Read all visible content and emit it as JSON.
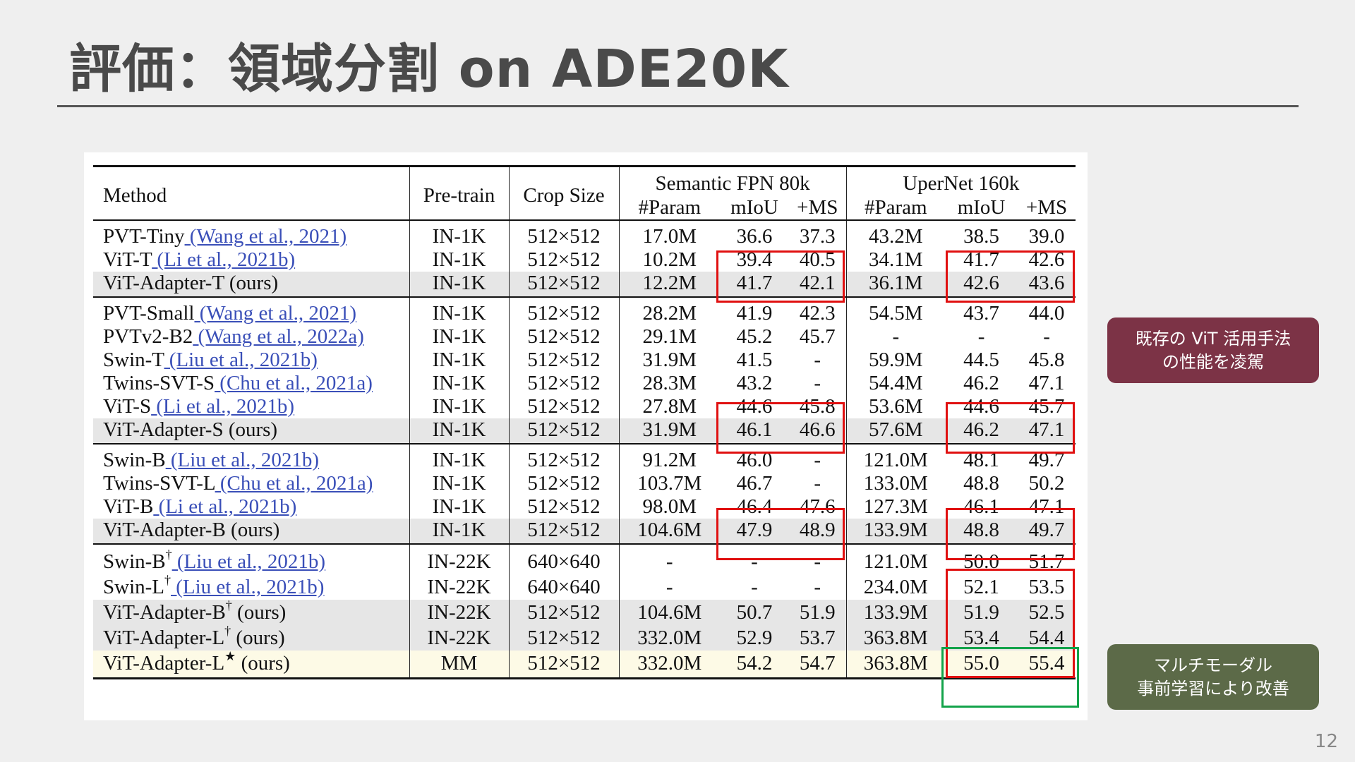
{
  "slide": {
    "title": "評価：領域分割 on ADE20K",
    "page_number": "12"
  },
  "table": {
    "header": {
      "method": "Method",
      "pretrain": "Pre-train",
      "crop": "Crop Size",
      "group1": "Semantic FPN 80k",
      "group2": "UperNet 160k",
      "param": "#Param",
      "miou": "mIoU",
      "ms": "+MS"
    },
    "groups": [
      [
        {
          "name": "PVT-Tiny",
          "cite": " (Wang et al., 2021)",
          "pretrain": "IN-1K",
          "crop": "512×512",
          "fpn_param": "17.0M",
          "fpn_miou": "36.6",
          "fpn_ms": "37.3",
          "up_param": "43.2M",
          "up_miou": "38.5",
          "up_ms": "39.0"
        },
        {
          "name": "ViT-T",
          "cite": " (Li et al., 2021b)",
          "pretrain": "IN-1K",
          "crop": "512×512",
          "fpn_param": "10.2M",
          "fpn_miou": "39.4",
          "fpn_ms": "40.5",
          "up_param": "34.1M",
          "up_miou": "41.7",
          "up_ms": "42.6"
        },
        {
          "name": "ViT-Adapter-T (ours)",
          "pretrain": "IN-1K",
          "crop": "512×512",
          "fpn_param": "12.2M",
          "fpn_miou": "41.7",
          "fpn_ms": "42.1",
          "up_param": "36.1M",
          "up_miou": "42.6",
          "up_ms": "43.6"
        }
      ],
      [
        {
          "name": "PVT-Small",
          "cite": " (Wang et al., 2021)",
          "pretrain": "IN-1K",
          "crop": "512×512",
          "fpn_param": "28.2M",
          "fpn_miou": "41.9",
          "fpn_ms": "42.3",
          "up_param": "54.5M",
          "up_miou": "43.7",
          "up_ms": "44.0"
        },
        {
          "name": "PVTv2-B2",
          "cite": " (Wang et al., 2022a)",
          "pretrain": "IN-1K",
          "crop": "512×512",
          "fpn_param": "29.1M",
          "fpn_miou": "45.2",
          "fpn_ms": "45.7",
          "up_param": "-",
          "up_miou": "-",
          "up_ms": "-"
        },
        {
          "name": "Swin-T",
          "cite": " (Liu et al., 2021b)",
          "pretrain": "IN-1K",
          "crop": "512×512",
          "fpn_param": "31.9M",
          "fpn_miou": "41.5",
          "fpn_ms": "-",
          "up_param": "59.9M",
          "up_miou": "44.5",
          "up_ms": "45.8"
        },
        {
          "name": "Twins-SVT-S",
          "cite": " (Chu et al., 2021a)",
          "pretrain": "IN-1K",
          "crop": "512×512",
          "fpn_param": "28.3M",
          "fpn_miou": "43.2",
          "fpn_ms": "-",
          "up_param": "54.4M",
          "up_miou": "46.2",
          "up_ms": "47.1"
        },
        {
          "name": "ViT-S",
          "cite": " (Li et al., 2021b)",
          "pretrain": "IN-1K",
          "crop": "512×512",
          "fpn_param": "27.8M",
          "fpn_miou": "44.6",
          "fpn_ms": "45.8",
          "up_param": "53.6M",
          "up_miou": "44.6",
          "up_ms": "45.7"
        },
        {
          "name": "ViT-Adapter-S (ours)",
          "pretrain": "IN-1K",
          "crop": "512×512",
          "fpn_param": "31.9M",
          "fpn_miou": "46.1",
          "fpn_ms": "46.6",
          "up_param": "57.6M",
          "up_miou": "46.2",
          "up_ms": "47.1"
        }
      ],
      [
        {
          "name": "Swin-B",
          "cite": " (Liu et al., 2021b)",
          "pretrain": "IN-1K",
          "crop": "512×512",
          "fpn_param": "91.2M",
          "fpn_miou": "46.0",
          "fpn_ms": "-",
          "up_param": "121.0M",
          "up_miou": "48.1",
          "up_ms": "49.7"
        },
        {
          "name": "Twins-SVT-L",
          "cite": " (Chu et al., 2021a)",
          "pretrain": "IN-1K",
          "crop": "512×512",
          "fpn_param": "103.7M",
          "fpn_miou": "46.7",
          "fpn_ms": "-",
          "up_param": "133.0M",
          "up_miou": "48.8",
          "up_ms": "50.2"
        },
        {
          "name": "ViT-B",
          "cite": " (Li et al., 2021b)",
          "pretrain": "IN-1K",
          "crop": "512×512",
          "fpn_param": "98.0M",
          "fpn_miou": "46.4",
          "fpn_ms": "47.6",
          "up_param": "127.3M",
          "up_miou": "46.1",
          "up_ms": "47.1"
        },
        {
          "name": "ViT-Adapter-B (ours)",
          "pretrain": "IN-1K",
          "crop": "512×512",
          "fpn_param": "104.6M",
          "fpn_miou": "47.9",
          "fpn_ms": "48.9",
          "up_param": "133.9M",
          "up_miou": "48.8",
          "up_ms": "49.7"
        }
      ],
      [
        {
          "name": "Swin-B",
          "sup": "†",
          "cite": " (Liu et al., 2021b)",
          "pretrain": "IN-22K",
          "crop": "640×640",
          "fpn_param": "-",
          "fpn_miou": "-",
          "fpn_ms": "-",
          "up_param": "121.0M",
          "up_miou": "50.0",
          "up_ms": "51.7"
        },
        {
          "name": "Swin-L",
          "sup": "†",
          "cite": " (Liu et al., 2021b)",
          "pretrain": "IN-22K",
          "crop": "640×640",
          "fpn_param": "-",
          "fpn_miou": "-",
          "fpn_ms": "-",
          "up_param": "234.0M",
          "up_miou": "52.1",
          "up_ms": "53.5"
        },
        {
          "name": "ViT-Adapter-B",
          "sup": "†",
          "suffix": " (ours)",
          "pretrain": "IN-22K",
          "crop": "512×512",
          "fpn_param": "104.6M",
          "fpn_miou": "50.7",
          "fpn_ms": "51.9",
          "up_param": "133.9M",
          "up_miou": "51.9",
          "up_ms": "52.5"
        },
        {
          "name": "ViT-Adapter-L",
          "sup": "†",
          "suffix": " (ours)",
          "pretrain": "IN-22K",
          "crop": "512×512",
          "fpn_param": "332.0M",
          "fpn_miou": "52.9",
          "fpn_ms": "53.7",
          "up_param": "363.8M",
          "up_miou": "53.4",
          "up_ms": "54.4"
        },
        {
          "name": "ViT-Adapter-L",
          "sup": "★",
          "suffix": " (ours)",
          "pretrain": "MM",
          "crop": "512×512",
          "fpn_param": "332.0M",
          "fpn_miou": "54.2",
          "fpn_ms": "54.7",
          "up_param": "363.8M",
          "up_miou": "55.0",
          "up_ms": "55.4"
        }
      ]
    ]
  },
  "callouts": {
    "red": {
      "line1": "既存の ViT 活用手法",
      "line2": "の性能を凌駕",
      "color": "#7c3346"
    },
    "green": {
      "line1": "マルチモーダル",
      "line2": "事前学習により改善",
      "color": "#5c6a48"
    }
  },
  "colors": {
    "highlight_red": "#e01010",
    "highlight_green": "#13a34a",
    "citation": "#3a4fb8"
  }
}
